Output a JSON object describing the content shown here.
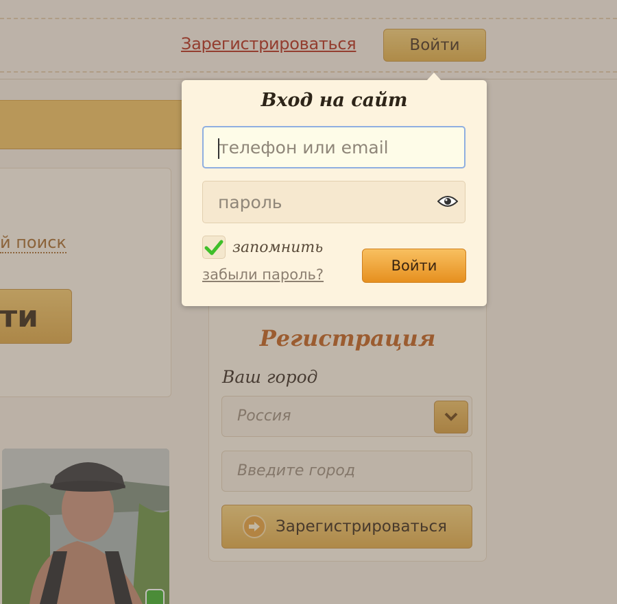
{
  "header": {
    "register_link": "Зарегистрироваться",
    "login_button": "Войти"
  },
  "left": {
    "advanced_search": "й поиск",
    "big_button": "йти"
  },
  "registration": {
    "title": "Регистрация",
    "city_label": "Ваш город",
    "country_value": "Россия",
    "city_placeholder": "Введите город",
    "submit": "Зарегистрироваться"
  },
  "login_popup": {
    "title": "Вход на сайт",
    "login_placeholder": "телефон или email",
    "password_placeholder": "пароль",
    "remember_label": "запомнить",
    "remember_checked": true,
    "forgot_link": "забыли пароль?",
    "submit": "Войти"
  },
  "icons": {
    "eye": "eye-icon",
    "checkmark": "checkmark-icon",
    "chevron": "chevron-down-icon",
    "arrow": "arrow-right-icon"
  },
  "colors": {
    "accent_orange": "#e6901f",
    "link_red": "#b3301c",
    "title_orange": "#c0621d",
    "check_green": "#3fbf2a",
    "online_green": "#3fae2a"
  }
}
